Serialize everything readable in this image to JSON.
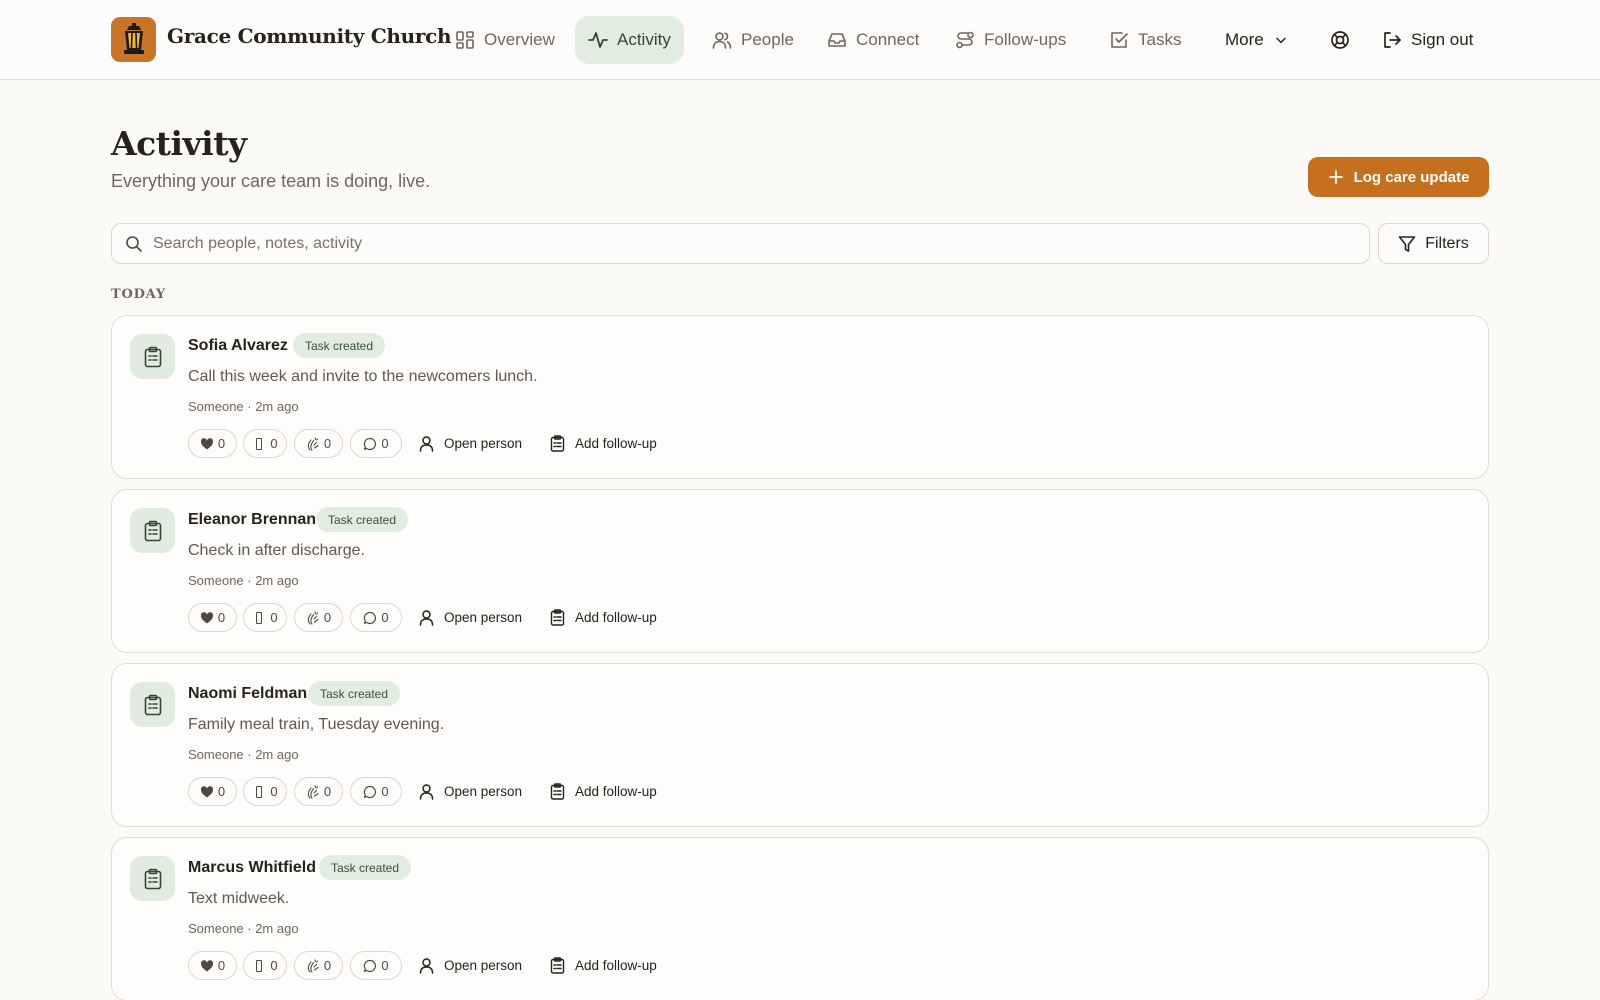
{
  "brand": {
    "name": "Grace Community Church",
    "logo_icon": "lantern-icon",
    "accent_color": "#c4701f"
  },
  "nav": {
    "items": [
      {
        "label": "Overview",
        "icon": "grid-icon"
      },
      {
        "label": "Activity",
        "icon": "activity-icon",
        "active": true
      },
      {
        "label": "People",
        "icon": "people-icon"
      },
      {
        "label": "Connect",
        "icon": "inbox-icon"
      },
      {
        "label": "Follow-ups",
        "icon": "route-icon"
      },
      {
        "label": "Tasks",
        "icon": "checkbox-icon"
      }
    ],
    "more_label": "More",
    "help_icon": "lifebuoy-icon",
    "sign_out_label": "Sign out"
  },
  "header": {
    "title": "Activity",
    "subtitle": "Everything your care team is doing, live.",
    "primary_button": "Log care update"
  },
  "search": {
    "placeholder": "Search people, notes, activity",
    "value": ""
  },
  "filters_label": "Filters",
  "section_label": "TODAY",
  "activities": [
    {
      "name": "Sofia Alvarez",
      "badge": "Task created",
      "note": "Call this week and invite to the newcomers lunch.",
      "meta": "Someone · 2m ago",
      "reactions": {
        "heart": "0",
        "pray": "0",
        "clap": "0",
        "comments": "0"
      }
    },
    {
      "name": "Eleanor Brennan",
      "badge": "Task created",
      "note": "Check in after discharge.",
      "meta": "Someone · 2m ago",
      "reactions": {
        "heart": "0",
        "pray": "0",
        "clap": "0",
        "comments": "0"
      }
    },
    {
      "name": "Naomi Feldman",
      "badge": "Task created",
      "note": "Family meal train, Tuesday evening.",
      "meta": "Someone · 2m ago",
      "reactions": {
        "heart": "0",
        "pray": "0",
        "clap": "0",
        "comments": "0"
      }
    },
    {
      "name": "Marcus Whitfield",
      "badge": "Task created",
      "note": "Text midweek.",
      "meta": "Someone · 2m ago",
      "reactions": {
        "heart": "0",
        "pray": "0",
        "clap": "0",
        "comments": "0"
      }
    }
  ],
  "card_actions": {
    "open_person": "Open person",
    "add_follow_up": "Add follow-up"
  }
}
